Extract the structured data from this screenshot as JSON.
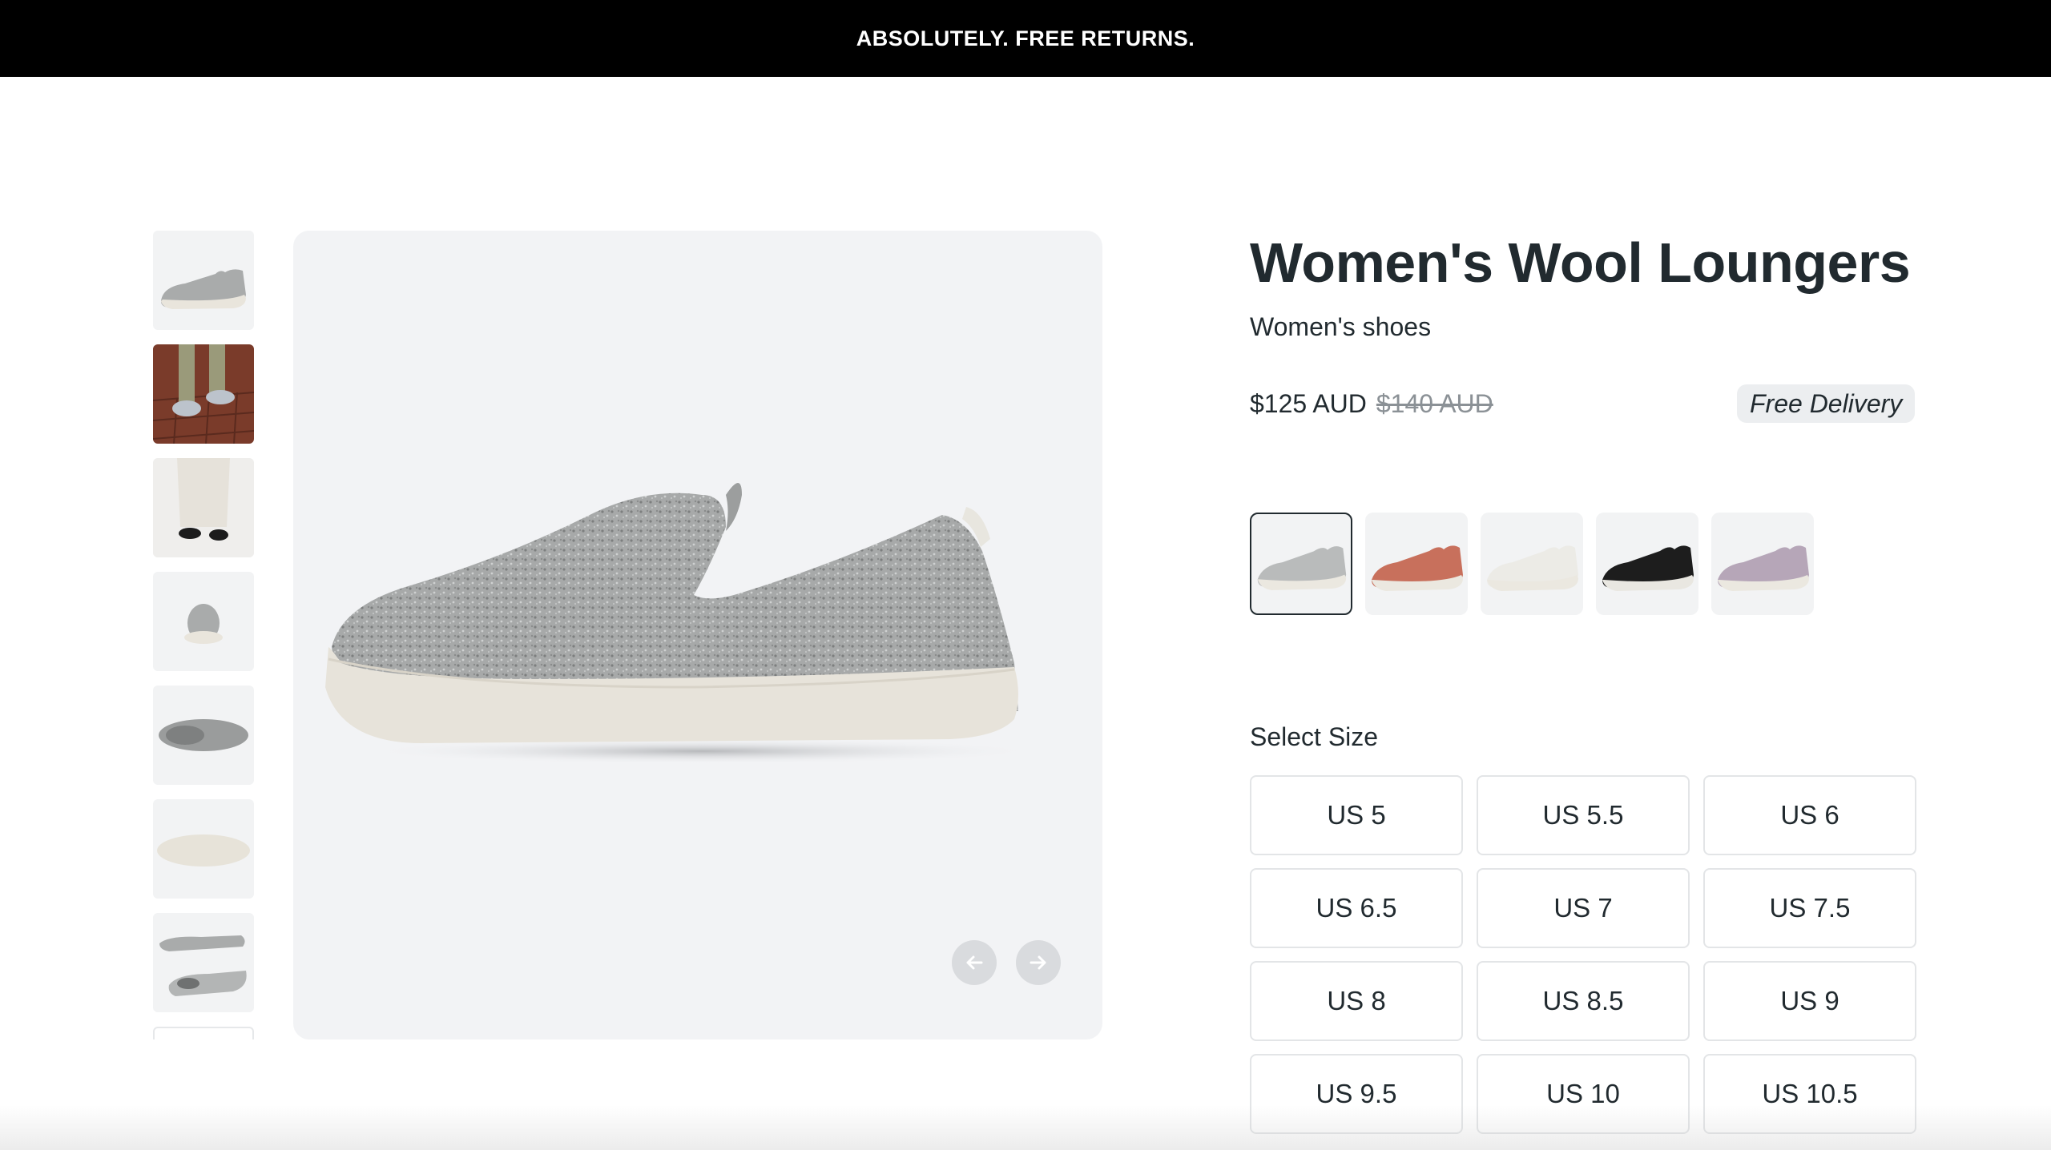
{
  "announcement": "ABSOLUTELY. FREE RETURNS.",
  "product": {
    "title": "Women's Wool Loungers",
    "subtitle": "Women's shoes",
    "price": "$125 AUD",
    "original_price": "$140 AUD",
    "badge": "Free Delivery"
  },
  "gallery": {
    "thumbnails": [
      "side-view",
      "lifestyle-brick",
      "lifestyle-white-pants",
      "back-view",
      "top-view",
      "sole-view",
      "pair-view",
      "partial"
    ],
    "prev_icon": "arrow-left-icon",
    "next_icon": "arrow-right-icon"
  },
  "colors": {
    "swatches": [
      {
        "name": "grey",
        "hex": "#b9bbbb",
        "selected": true
      },
      {
        "name": "coral",
        "hex": "#c8705c",
        "selected": false
      },
      {
        "name": "white",
        "hex": "#ecebe6",
        "selected": false
      },
      {
        "name": "black",
        "hex": "#1d1d1d",
        "selected": false
      },
      {
        "name": "lilac",
        "hex": "#b6a6b8",
        "selected": false
      }
    ],
    "accent": "#212a2f"
  },
  "sizes": {
    "label": "Select Size",
    "options": [
      "US 5",
      "US 5.5",
      "US 6",
      "US 6.5",
      "US 7",
      "US 7.5",
      "US 8",
      "US 8.5",
      "US 9",
      "US 9.5",
      "US 10",
      "US 10.5"
    ]
  }
}
